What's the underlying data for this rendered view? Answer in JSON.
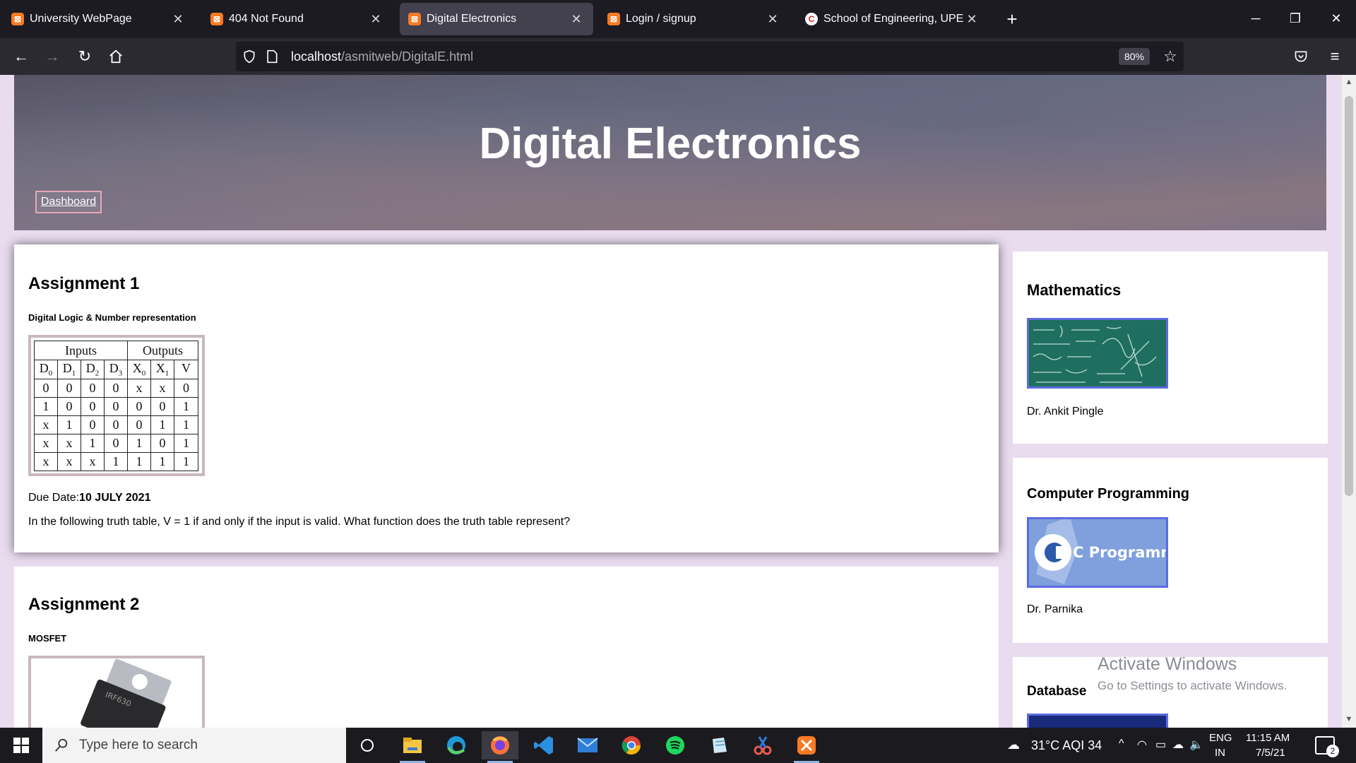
{
  "browser": {
    "tabs": [
      {
        "title": "University WebPage",
        "icon": "xampp-icon",
        "active": false
      },
      {
        "title": "404 Not Found",
        "icon": "xampp-icon",
        "active": false
      },
      {
        "title": "Digital Electronics",
        "icon": "xampp-icon",
        "active": true
      },
      {
        "title": "Login / signup",
        "icon": "xampp-icon",
        "active": false
      },
      {
        "title": "School of Engineering, UPES De",
        "icon": "upes-icon",
        "active": false
      }
    ],
    "url_host": "localhost",
    "url_path": "/asmitweb/DigitalE.html",
    "zoom": "80%"
  },
  "page": {
    "hero_title": "Digital Electronics",
    "dashboard_label": "Dashboard",
    "assignments": [
      {
        "title": "Assignment 1",
        "subtitle": "Digital Logic & Number representation",
        "truth_table": {
          "group_headers": [
            "Inputs",
            "Outputs"
          ],
          "columns": [
            "D0",
            "D1",
            "D2",
            "D3",
            "X0",
            "X1",
            "V"
          ],
          "rows": [
            [
              "0",
              "0",
              "0",
              "0",
              "x",
              "x",
              "0"
            ],
            [
              "1",
              "0",
              "0",
              "0",
              "0",
              "0",
              "1"
            ],
            [
              "x",
              "1",
              "0",
              "0",
              "0",
              "1",
              "1"
            ],
            [
              "x",
              "x",
              "1",
              "0",
              "1",
              "0",
              "1"
            ],
            [
              "x",
              "x",
              "x",
              "1",
              "1",
              "1",
              "1"
            ]
          ]
        },
        "due_label": "Due Date:",
        "due_date": "10 JULY 2021",
        "question": "In the following truth table, V = 1 if and only if the input is valid. What function does the truth table represent?"
      },
      {
        "title": "Assignment 2",
        "subtitle": "MOSFET",
        "image_text": "IRF630"
      }
    ],
    "courses": [
      {
        "title": "Mathematics",
        "instructor": "Dr. Ankit Pingle",
        "image": "math-chalkboard"
      },
      {
        "title": "Computer Programming",
        "instructor": "Dr. Parnika",
        "image": "c-programming-logo",
        "image_text": "C Programming"
      },
      {
        "title": "Database",
        "instructor": "",
        "image": "database"
      }
    ],
    "activation": {
      "line1": "Activate Windows",
      "line2": "Go to Settings to activate Windows."
    }
  },
  "taskbar": {
    "search_placeholder": "Type here to search",
    "weather": "31°C  AQI 34",
    "language": "ENG",
    "region": "IN",
    "time": "11:15 AM",
    "date": "7/5/21",
    "notifications": "2"
  },
  "colors": {
    "page_bg": "#e9dcef",
    "card_border_accent": "#5b6be0",
    "dashboard_border": "#e6a8b6"
  }
}
